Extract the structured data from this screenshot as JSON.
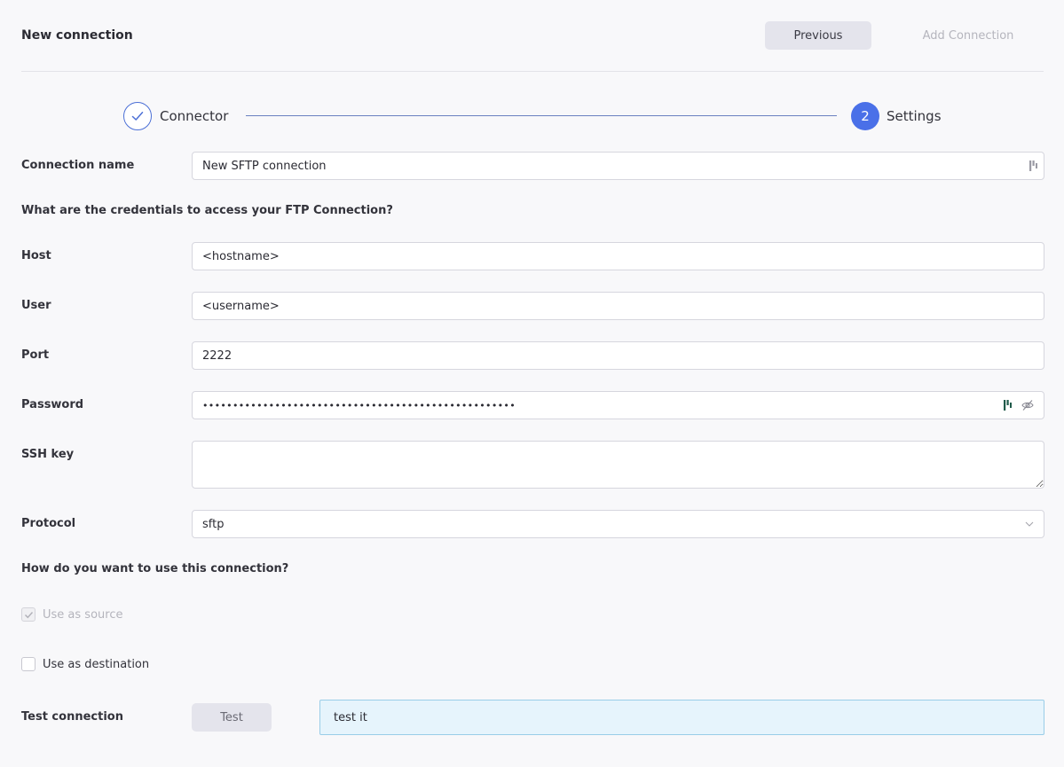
{
  "header": {
    "title": "New connection",
    "previous_label": "Previous",
    "add_label": "Add Connection"
  },
  "stepper": {
    "steps": [
      {
        "label": "Connector",
        "state": "done"
      },
      {
        "label": "Settings",
        "number": "2",
        "state": "active"
      }
    ]
  },
  "form": {
    "connection_name": {
      "label": "Connection name",
      "value": "New SFTP connection"
    },
    "credentials_heading": "What are the credentials to access your FTP Connection?",
    "host": {
      "label": "Host",
      "value": "<hostname>"
    },
    "user": {
      "label": "User",
      "value": "<username>"
    },
    "port": {
      "label": "Port",
      "value": "2222"
    },
    "password": {
      "label": "Password",
      "value": "••••••••••••••••••••••••••••••••••••••••••••••••••••"
    },
    "ssh_key": {
      "label": "SSH key",
      "value": ""
    },
    "protocol": {
      "label": "Protocol",
      "value": "sftp"
    },
    "usage_heading": "How do you want to use this connection?",
    "use_as_source": {
      "label": "Use as source",
      "checked": true,
      "disabled": true
    },
    "use_as_destination": {
      "label": "Use as destination",
      "checked": false
    },
    "test_connection": {
      "label": "Test connection",
      "button_label": "Test",
      "result": "test it"
    }
  },
  "colors": {
    "accent": "#4a70e8",
    "info_bg": "#e6f4fc",
    "info_border": "#99cde8"
  },
  "icons": {
    "step_done": "check-icon",
    "password_manager": "password-manager-icon",
    "visibility": "eye-off-icon",
    "dropdown": "chevron-down-icon"
  }
}
